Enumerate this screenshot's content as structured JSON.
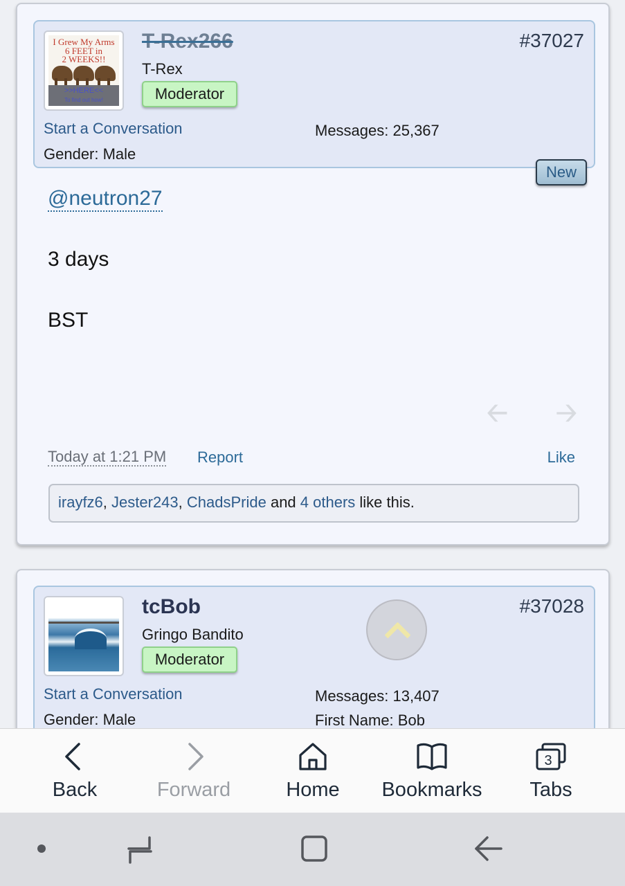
{
  "posts": [
    {
      "username": "T-Rex266",
      "user_title": "T-Rex",
      "badge": "Moderator",
      "post_number": "#37027",
      "start_conversation": "Start a Conversation",
      "gender": "Gender:  Male",
      "messages": "Messages:  25,367",
      "new_badge": "New",
      "avatar_text": {
        "line1": "I Grew My Arms",
        "line2": "6 FEET in",
        "line3": "2 WEEKS!!",
        "line4": ">>HERE<<",
        "line5": "To find out how!"
      },
      "body": {
        "mention": "@neutron27",
        "line1": "3 days",
        "line2": "BST"
      },
      "timestamp": "Today at 1:21 PM",
      "report": "Report",
      "like": "Like",
      "likes": {
        "user1": "irayfz6",
        "sep1": ", ",
        "user2": "Jester243",
        "sep2": ", ",
        "user3": "ChadsPride",
        "and": " and ",
        "others": "4 others",
        "suffix": " like this."
      }
    },
    {
      "username": "tcBob",
      "user_title": "Gringo Bandito",
      "badge": "Moderator",
      "post_number": "#37028",
      "start_conversation": "Start a Conversation",
      "gender": "Gender:  Male",
      "messages": "Messages:  13,407",
      "first_name": "First Name:  Bob"
    }
  ],
  "toolbar": {
    "back": "Back",
    "forward": "Forward",
    "home": "Home",
    "bookmarks": "Bookmarks",
    "tabs": "Tabs",
    "tab_count": "3"
  },
  "icons": {
    "nav_prev": "arrow-left-icon",
    "nav_next": "arrow-right-icon",
    "scroll_top": "chevron-up-icon"
  }
}
